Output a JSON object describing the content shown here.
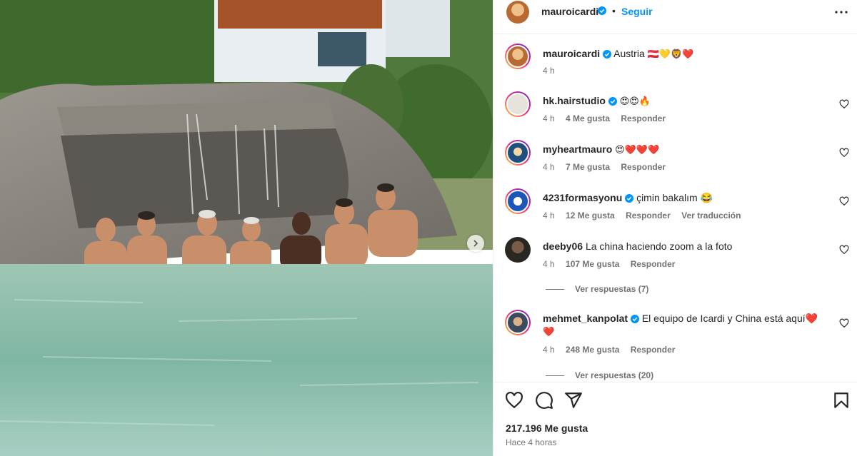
{
  "post": {
    "author": "mauroicardi",
    "follow_label": "Seguir",
    "separator": "•",
    "caption": "Austria",
    "caption_emojis": "🇦🇹💛🦁❤️",
    "time": "4 h",
    "likes": "217.196 Me gusta",
    "time_ago": "Hace 4 horas"
  },
  "comments": [
    {
      "user": "hk.hairstudio",
      "verified": true,
      "text": "😍😍🔥",
      "time": "4 h",
      "likes": "4 Me gusta",
      "reply": "Responder"
    },
    {
      "user": "myheartmauro",
      "verified": false,
      "text": "😍❤️❤️❤️",
      "time": "4 h",
      "likes": "7 Me gusta",
      "reply": "Responder"
    },
    {
      "user": "4231formasyonu",
      "verified": true,
      "text": "çimin bakalım 😂",
      "time": "4 h",
      "likes": "12 Me gusta",
      "reply": "Responder",
      "translate": "Ver traducción"
    },
    {
      "user": "deeby06",
      "verified": false,
      "text": "La china haciendo zoom a la foto",
      "time": "4 h",
      "likes": "107 Me gusta",
      "reply": "Responder",
      "view_replies": "Ver respuestas (7)"
    },
    {
      "user": "mehmet_kanpolat",
      "verified": true,
      "text": "El equipo de Icardi y China está aquí❤️",
      "text2": "❤️",
      "time": "4 h",
      "likes": "248 Me gusta",
      "reply": "Responder",
      "view_replies": "Ver respuestas (20)"
    }
  ],
  "icons": {
    "verified": "verified-badge-icon",
    "more": "more-options-icon",
    "like": "heart-icon",
    "comment": "comment-icon",
    "share": "share-icon",
    "save": "bookmark-icon",
    "next": "chevron-right-icon"
  },
  "colors": {
    "link": "#0095f6",
    "verified": "#0095f6",
    "secondary_text": "#737373",
    "heart": "#ed4956"
  }
}
